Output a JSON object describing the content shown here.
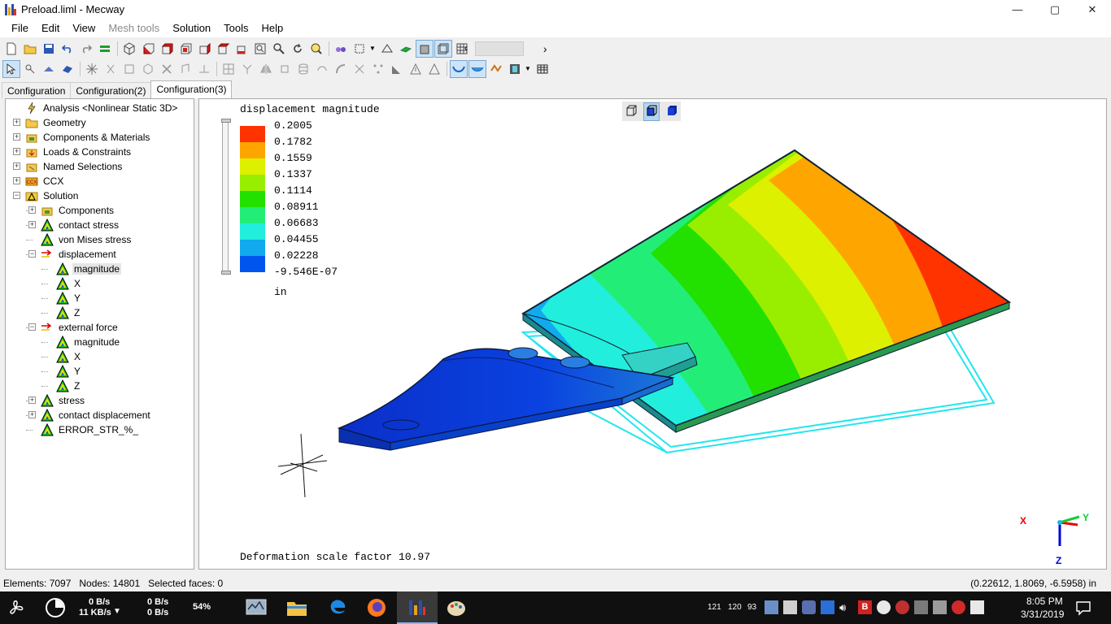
{
  "window": {
    "title": "Preload.liml - Mecway",
    "controls": {
      "minimize": "—",
      "maximize": "▢",
      "close": "✕"
    }
  },
  "menu": [
    {
      "label": "File",
      "enabled": true
    },
    {
      "label": "Edit",
      "enabled": true
    },
    {
      "label": "View",
      "enabled": true
    },
    {
      "label": "Mesh tools",
      "enabled": false
    },
    {
      "label": "Solution",
      "enabled": true
    },
    {
      "label": "Tools",
      "enabled": true
    },
    {
      "label": "Help",
      "enabled": true
    }
  ],
  "tabs": [
    {
      "label": "Configuration",
      "active": false
    },
    {
      "label": "Configuration(2)",
      "active": false
    },
    {
      "label": "Configuration(3)",
      "active": true
    }
  ],
  "tree": [
    {
      "label": "Analysis <Nonlinear Static 3D>",
      "icon": "analysis-bolt-icon",
      "depth": 0,
      "expander": ""
    },
    {
      "label": "Geometry",
      "icon": "folder-icon",
      "depth": 0,
      "expander": "+"
    },
    {
      "label": "Components & Materials",
      "icon": "components-icon",
      "depth": 0,
      "expander": "+"
    },
    {
      "label": "Loads & Constraints",
      "icon": "loads-icon",
      "depth": 0,
      "expander": "+"
    },
    {
      "label": "Named Selections",
      "icon": "named-selection-icon",
      "depth": 0,
      "expander": "+"
    },
    {
      "label": "CCX",
      "icon": "ccx-icon",
      "depth": 0,
      "expander": "+"
    },
    {
      "label": "Solution",
      "icon": "solution-triangle-icon",
      "depth": 0,
      "expander": "-"
    },
    {
      "label": "Components",
      "icon": "components-icon",
      "depth": 1,
      "expander": "+"
    },
    {
      "label": "contact stress",
      "icon": "result-triangle-icon",
      "depth": 1,
      "expander": "+"
    },
    {
      "label": "von Mises stress",
      "icon": "result-triangle-icon",
      "depth": 1,
      "expander": ""
    },
    {
      "label": "displacement",
      "icon": "vector-arrow-icon",
      "depth": 1,
      "expander": "-"
    },
    {
      "label": "magnitude",
      "icon": "result-triangle-icon",
      "depth": 2,
      "expander": "",
      "selected": true
    },
    {
      "label": "X",
      "icon": "result-triangle-icon",
      "depth": 2,
      "expander": ""
    },
    {
      "label": "Y",
      "icon": "result-triangle-icon",
      "depth": 2,
      "expander": ""
    },
    {
      "label": "Z",
      "icon": "result-triangle-icon",
      "depth": 2,
      "expander": ""
    },
    {
      "label": "external force",
      "icon": "vector-arrow-icon",
      "depth": 1,
      "expander": "-"
    },
    {
      "label": "magnitude",
      "icon": "result-triangle-icon",
      "depth": 2,
      "expander": ""
    },
    {
      "label": "X",
      "icon": "result-triangle-icon",
      "depth": 2,
      "expander": ""
    },
    {
      "label": "Y",
      "icon": "result-triangle-icon",
      "depth": 2,
      "expander": ""
    },
    {
      "label": "Z",
      "icon": "result-triangle-icon",
      "depth": 2,
      "expander": ""
    },
    {
      "label": "stress",
      "icon": "result-triangle-icon",
      "depth": 1,
      "expander": "+"
    },
    {
      "label": "contact displacement",
      "icon": "result-triangle-icon",
      "depth": 1,
      "expander": "+"
    },
    {
      "label": "ERROR_STR_%_",
      "icon": "result-triangle-icon",
      "depth": 1,
      "expander": ""
    }
  ],
  "viewport": {
    "result_title": "displacement magnitude",
    "legend": {
      "values": [
        "0.2005",
        "0.1782",
        "0.1559",
        "0.1337",
        "0.1114",
        "0.08911",
        "0.06683",
        "0.04455",
        "0.02228",
        "-9.546E-07"
      ],
      "colors": [
        "#ff3300",
        "#ffa500",
        "#dcf000",
        "#99ee00",
        "#22e000",
        "#22ee77",
        "#22eedd",
        "#11aaee",
        "#0055ee"
      ],
      "unit": "in"
    },
    "deformation_text": "Deformation scale factor 10.97",
    "axis_labels": {
      "x": "X",
      "y": "Y",
      "z": "Z"
    },
    "view_buttons": [
      "wireframe-cube-icon",
      "shaded-cube-icon",
      "solid-cube-icon"
    ]
  },
  "status": {
    "elements": "Elements: 7097",
    "nodes": "Nodes: 14801",
    "selected": "Selected faces: 0",
    "coords": "(0.22612, 1.8069, -6.5958) in"
  },
  "taskbar": {
    "net_up": "0 B/s",
    "net_down": "11 KB/s",
    "net_arrow": "▼",
    "disk_read": "0 B/s",
    "disk_write": "0 B/s",
    "cpu": "54%",
    "tray_nums": [
      "121",
      "120",
      "93"
    ],
    "time": "8:05 PM",
    "date": "3/31/2019"
  }
}
